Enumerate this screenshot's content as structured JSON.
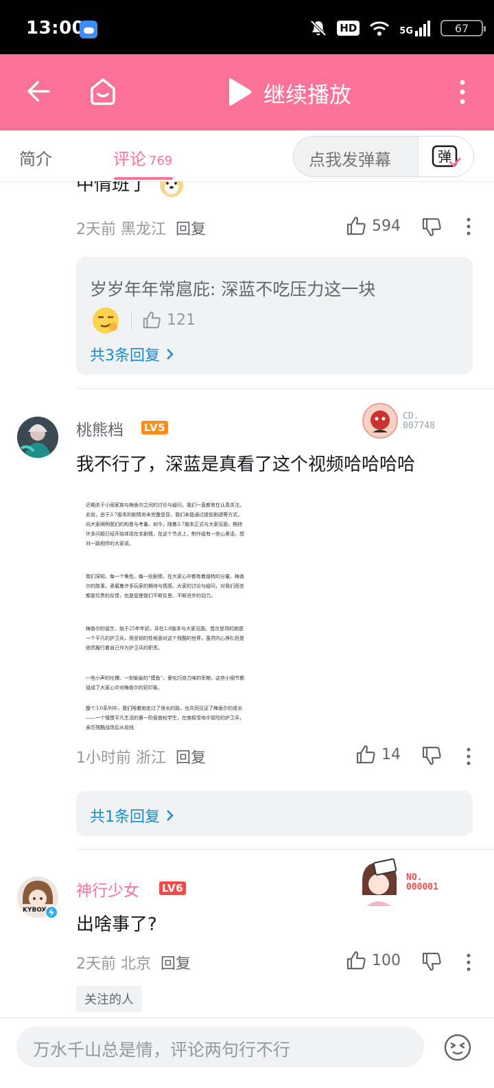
{
  "status_bar": {
    "time": "13:00",
    "network": "5G",
    "hd": "HD",
    "battery": "67"
  },
  "nav": {
    "title": "继续播放"
  },
  "tabs": {
    "intro": "简介",
    "comments": "评论",
    "comment_count": "769",
    "danmaku_placeholder": "点我发弹幕",
    "danmaku_button": "弹"
  },
  "comments": [
    {
      "partial_text": "中情班了",
      "time": "2天前",
      "location": "黑龙江",
      "reply_label": "回复",
      "likes": "594",
      "replies": {
        "preview_user": "岁岁年年常扈庇",
        "preview_text": ": 深蓝不吃压力这一块",
        "preview_likes": "121",
        "link": "共3条回复"
      }
    },
    {
      "user": "桃熊档",
      "level": "LV5",
      "badge": "CD. 007748",
      "badge_line1": "CD.",
      "badge_line2": "007748",
      "text": "我不行了，深蓝是真看了这个视频哈哈哈哈",
      "image_paragraphs": [
        "近期关于小雨家族与梅香尔之间的讨论与疑问，我们一直都有在认真关注。此前，由于3.7版本的剧情尚未完整呈现，我们未能通过提前剧透等方式，向大家阐明我们的构思与考量。如今，随着3.7版本正式与大家见面，期待许多问题已经开始体现在本剧情，在这个节点上，制作组有一些心里话，想对一路相伴的大家说。",
        "我们深知，每一个角色、每一段剧情，在大家心中都有着独特的分量。梅香尔的故事，承载着许多玩家的期待与情感，大家的讨论与疑问，对我们而言都是珍贵的反馈，也是促使我们不断反思、不断进步的动力。",
        "梅香尔的诞生，始于25年年初，并在2.8版本与大家见面。首次登场的她是一个平凡的护卫兵，用坚韧的性格面对这个残酷的世界，虽然内心挣扎但是依然履行着自己作为护卫兵的职责。",
        "一些小声的吐槽、一刻偷偷的“摸鱼”，爱吃巧克力味的军粮，这些小细节都组成了大家心中对梅香尔的初印象。",
        "整个3.0系列中，我们陪着她走过了很长的路，也共同见证了梅香尔的成长——一个憧憬平凡生活的第一阶级普权学生，在南极雪地中冒险的护卫兵，亲历残酷战场后从前线"
      ],
      "time": "1小时前",
      "location": "浙江",
      "reply_label": "回复",
      "likes": "14",
      "replies": {
        "link": "共1条回复"
      }
    },
    {
      "user": "神行少女",
      "level": "LV6",
      "badge": "NO. 000001",
      "badge_line1": "NO.",
      "badge_line2": "000001",
      "avatar_text": "KYBOX",
      "text": "出啥事了?",
      "time": "2天前",
      "location": "北京",
      "reply_label": "回复",
      "likes": "100",
      "tag": "关注的人"
    }
  ],
  "bottom": {
    "input_placeholder": "万水千山总是情，评论两句行不行"
  },
  "colors": {
    "brand_pink": "#fb7299",
    "link_blue": "#178bcf",
    "level_orange": "#ff8c1a",
    "level_red": "#f04c49"
  }
}
